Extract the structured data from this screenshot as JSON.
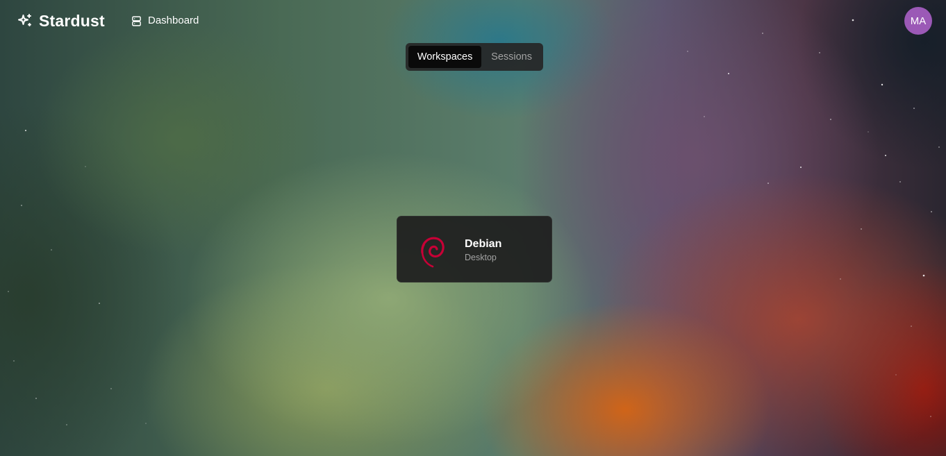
{
  "app": {
    "name": "Stardust",
    "logo_icon": "sparkles-icon"
  },
  "nav": {
    "dashboard_label": "Dashboard",
    "dashboard_icon": "server-icon"
  },
  "user": {
    "initials": "MA",
    "avatar_color": "#9b59b6"
  },
  "tabs": [
    {
      "label": "Workspaces",
      "active": true
    },
    {
      "label": "Sessions",
      "active": false
    }
  ],
  "workspaces": [
    {
      "name": "Debian",
      "type": "Desktop",
      "icon": "debian-logo-icon",
      "brand_color": "#c70036"
    }
  ]
}
